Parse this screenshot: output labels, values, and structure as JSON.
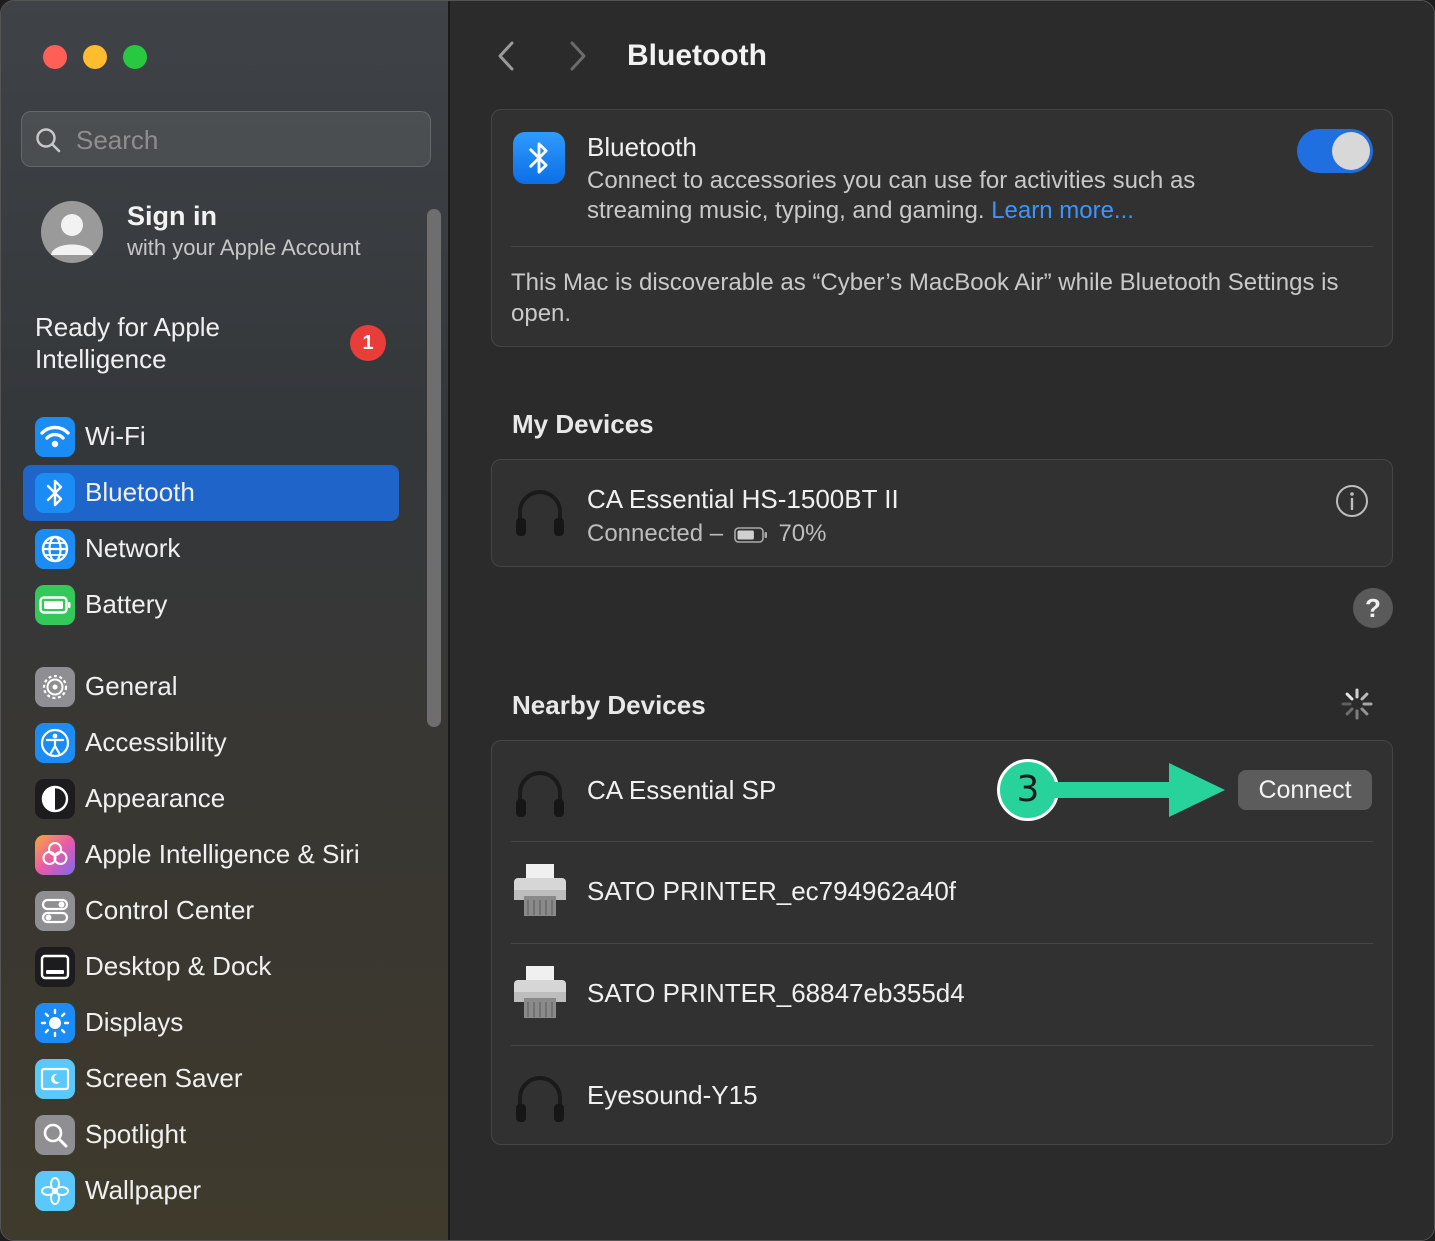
{
  "window": {
    "controls": [
      "close",
      "minimize",
      "zoom"
    ]
  },
  "sidebar": {
    "search": {
      "placeholder": "Search",
      "value": ""
    },
    "account": {
      "title": "Sign in",
      "subtitle": "with your Apple Account"
    },
    "ai_ready": {
      "label": "Ready for Apple Intelligence",
      "badge": "1"
    },
    "items": [
      {
        "label": "Wi-Fi",
        "icon": "wifi-icon",
        "color": "#1c8cf5"
      },
      {
        "label": "Bluetooth",
        "icon": "bluetooth-icon",
        "color": "#1c8cf5",
        "active": true
      },
      {
        "label": "Network",
        "icon": "globe-icon",
        "color": "#1c8cf5"
      },
      {
        "label": "Battery",
        "icon": "battery-icon",
        "color": "#34c759"
      },
      {
        "label": "General",
        "icon": "gear-icon",
        "color": "#8e8e93"
      },
      {
        "label": "Accessibility",
        "icon": "accessibility-icon",
        "color": "#1c8cf5"
      },
      {
        "label": "Appearance",
        "icon": "appearance-icon",
        "color": "#1c1c1e"
      },
      {
        "label": "Apple Intelligence & Siri",
        "icon": "siri-icon",
        "color": "#e85aa8"
      },
      {
        "label": "Control Center",
        "icon": "control-center-icon",
        "color": "#8e8e93"
      },
      {
        "label": "Desktop & Dock",
        "icon": "dock-icon",
        "color": "#1c1c1e"
      },
      {
        "label": "Displays",
        "icon": "sun-icon",
        "color": "#1c8cf5"
      },
      {
        "label": "Screen Saver",
        "icon": "screen-saver-icon",
        "color": "#5ac8fa"
      },
      {
        "label": "Spotlight",
        "icon": "magnifier-icon",
        "color": "#8e8e93"
      },
      {
        "label": "Wallpaper",
        "icon": "flower-icon",
        "color": "#5ac8fa"
      }
    ]
  },
  "main": {
    "title": "Bluetooth",
    "bluetooth_card": {
      "title": "Bluetooth",
      "description": "Connect to accessories you can use for activities such as streaming music, typing, and gaming.",
      "link": "Learn more...",
      "toggle_on": true,
      "discoverable": "This Mac is discoverable as “Cyber’s MacBook Air” while Bluetooth Settings is open."
    },
    "my_devices": {
      "title": "My Devices",
      "devices": [
        {
          "name": "CA Essential HS-1500BT II",
          "status": "Connected –",
          "battery": "70%",
          "battery_level": 0.7,
          "icon": "headphones-icon"
        }
      ]
    },
    "help": "?",
    "nearby_devices": {
      "title": "Nearby Devices",
      "devices": [
        {
          "name": "CA Essential SP",
          "icon": "headphones-icon",
          "action": "Connect"
        },
        {
          "name": "SATO PRINTER_ec794962a40f",
          "icon": "printer-icon"
        },
        {
          "name": "SATO PRINTER_68847eb355d4",
          "icon": "printer-icon"
        },
        {
          "name": "Eyesound-Y15",
          "icon": "headphones-icon"
        }
      ]
    },
    "annotation": {
      "step": "3",
      "color": "#27d39b"
    }
  }
}
